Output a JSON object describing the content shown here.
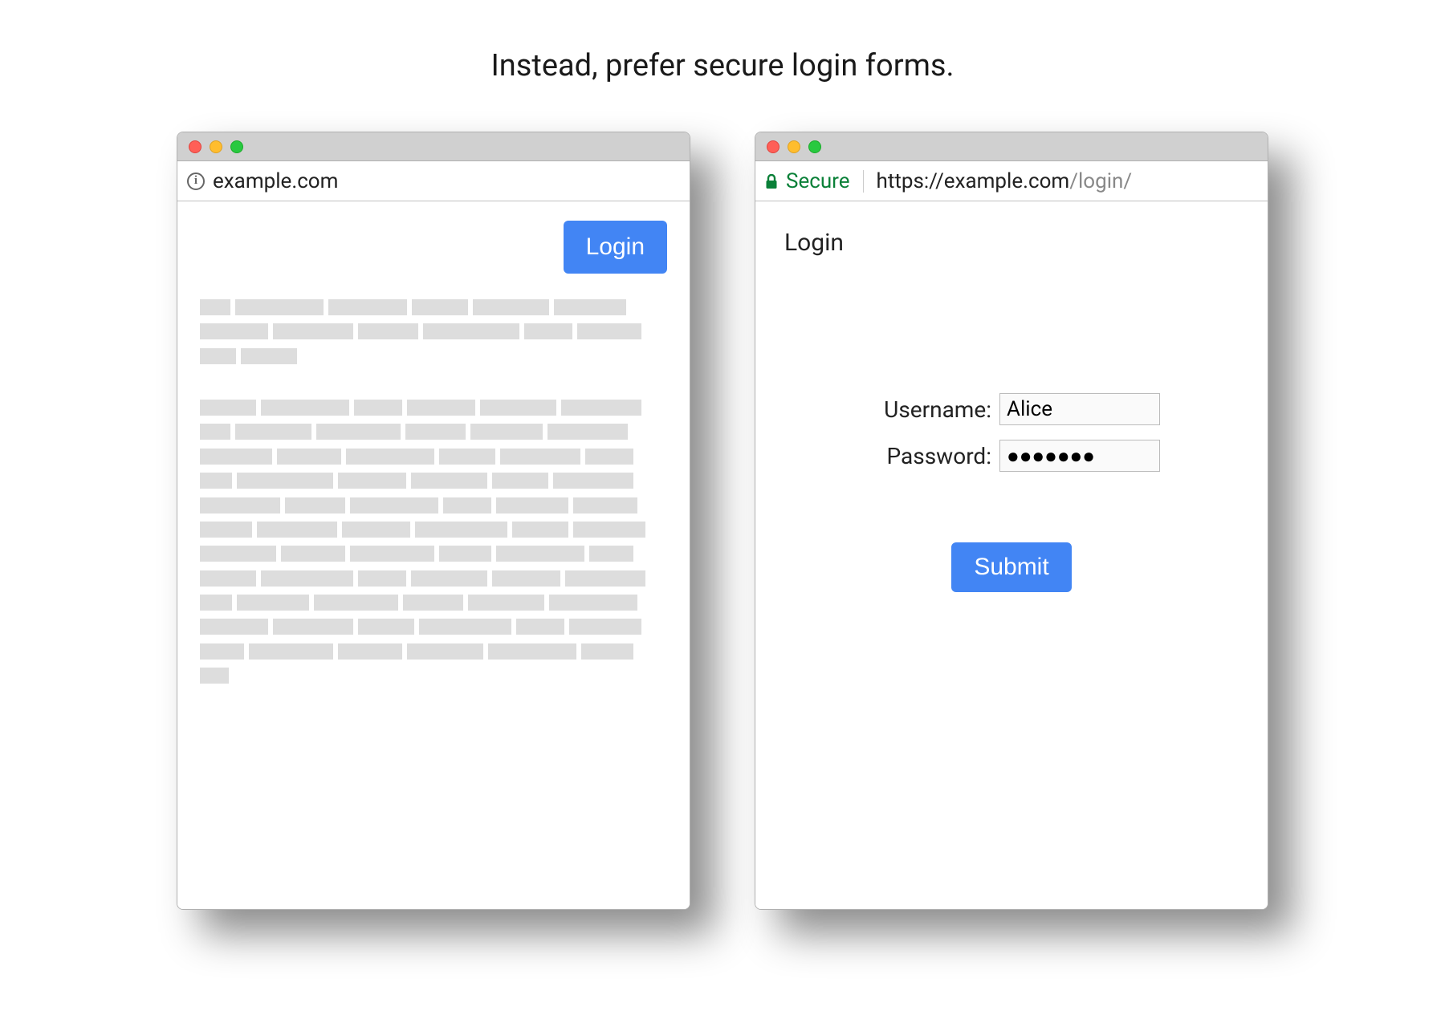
{
  "title": "Instead, prefer secure login forms.",
  "left_window": {
    "url": "example.com",
    "login_button": "Login"
  },
  "right_window": {
    "secure_label": "Secure",
    "url_scheme_host": "https://example.com",
    "url_path": "/login/",
    "heading": "Login",
    "username_label": "Username:",
    "username_value": "Alice",
    "password_label": "Password:",
    "password_value": "●●●●●●●",
    "submit_button": "Submit"
  }
}
